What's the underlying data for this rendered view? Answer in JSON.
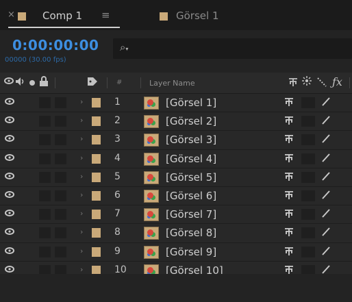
{
  "tabs": [
    {
      "label": "Comp 1",
      "close_glyph": "×",
      "menu_glyph": "≡",
      "active": true
    },
    {
      "label": "Görsel 1",
      "active": false
    }
  ],
  "timecode": "0:00:00:00",
  "fps_text": "00000 (30.00 fps)",
  "search_icon": "search-icon",
  "header": {
    "num_label": "#",
    "layer_name_label": "Layer Name",
    "icons": [
      "eye-icon",
      "audio-icon",
      "solo-icon",
      "lock-icon",
      "label-tag-icon",
      "shy-icon",
      "collapse-icon",
      "quality-icon",
      "fx-icon"
    ]
  },
  "layers": [
    {
      "num": "1",
      "name": "[Görsel 1]"
    },
    {
      "num": "2",
      "name": "[Görsel 2]"
    },
    {
      "num": "3",
      "name": "[Görsel 3]"
    },
    {
      "num": "4",
      "name": "[Görsel 4]"
    },
    {
      "num": "5",
      "name": "[Görsel 5]"
    },
    {
      "num": "6",
      "name": "[Görsel 6]"
    },
    {
      "num": "7",
      "name": "[Görsel 7]"
    },
    {
      "num": "8",
      "name": "[Görsel 8]"
    },
    {
      "num": "9",
      "name": "[Görsel 9]"
    },
    {
      "num": "10",
      "name": "[Görsel 10]"
    }
  ],
  "colors": {
    "timecode": "#3d8ee0",
    "label_sandstone": "#c9a979",
    "panel_bg": "#232323"
  }
}
